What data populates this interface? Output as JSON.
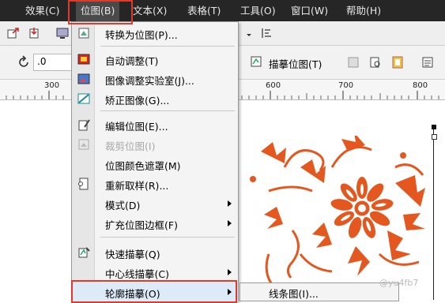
{
  "menubar": {
    "items": [
      {
        "label": "效果(C)"
      },
      {
        "label": "位图(B)"
      },
      {
        "label": "文本(X)"
      },
      {
        "label": "表格(T)"
      },
      {
        "label": "工具(O)"
      },
      {
        "label": "窗口(W)"
      },
      {
        "label": "帮助(H)"
      }
    ],
    "active_index": 1
  },
  "toolbar2": {
    "rotation_value": ".0",
    "trace_bitmap_label": "描摹位图(T)"
  },
  "ruler": {
    "ticks": [
      "300",
      "600",
      "700",
      "800"
    ]
  },
  "bitmap_menu": {
    "items": [
      {
        "label": "转换为位图(P)...",
        "enabled": true
      },
      {
        "label": "自动调整(T)",
        "enabled": true
      },
      {
        "label": "图像调整实验室(J)...",
        "enabled": true
      },
      {
        "label": "矫正图像(G)...",
        "enabled": true
      },
      {
        "label": "编辑位图(E)...",
        "enabled": true
      },
      {
        "label": "裁剪位图(I)",
        "enabled": false
      },
      {
        "label": "位图颜色遮罩(M)",
        "enabled": true
      },
      {
        "label": "重新取样(R)...",
        "enabled": true
      },
      {
        "label": "模式(D)",
        "enabled": true
      },
      {
        "label": "扩充位图边框(F)",
        "enabled": true
      },
      {
        "label": "快速描摹(Q)",
        "enabled": true
      },
      {
        "label": "中心线描摹(C)",
        "enabled": true
      },
      {
        "label": "轮廓描摹(O)",
        "enabled": true
      }
    ]
  },
  "submenu": {
    "first_item": "线条图(I)..."
  },
  "watermark": "@yu4fb7",
  "colors": {
    "menubar_bg": "#262626",
    "highlight_box": "#e23a2a",
    "flower": "#e4571f"
  },
  "icons": [
    "rotate-icon",
    "trace-bitmap-icon",
    "convert-bitmap-icon",
    "auto-adjust-icon",
    "image-lab-icon",
    "straighten-icon",
    "edit-bitmap-icon",
    "crop-bitmap-icon",
    "resample-icon",
    "quick-trace-icon"
  ]
}
